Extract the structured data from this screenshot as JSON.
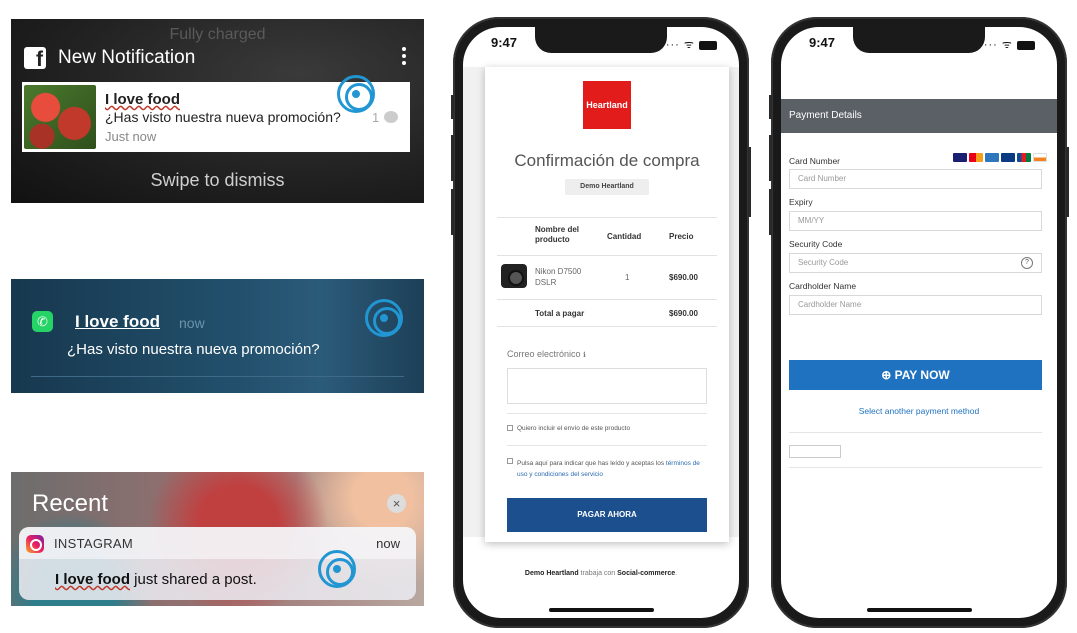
{
  "facebook": {
    "charging": "Fully charged",
    "header": "New Notification",
    "sender": "I love food",
    "message": "¿Has visto nuestra nueva promoción?",
    "time": "Just now",
    "count": "1",
    "swipe": "Swipe to dismiss"
  },
  "whatsapp": {
    "sender": "I love food",
    "time": "now",
    "message": "¿Has visto nuestra nueva promoción?"
  },
  "instagram": {
    "recent": "Recent",
    "close": "×",
    "app": "INSTAGRAM",
    "time": "now",
    "sender": "I love food",
    "message": " just shared a post."
  },
  "checkout": {
    "time": "9:47",
    "logo": "Heartland",
    "title": "Confirmación de compra",
    "badge": "Demo Heartland",
    "col_name": "Nombre del producto",
    "col_qty": "Cantidad",
    "col_price": "Precio",
    "item_name": "Nikon D7500 DSLR",
    "item_qty": "1",
    "item_price": "$690.00",
    "total_label": "Total a pagar",
    "total_value": "$690.00",
    "email_label": "Correo electrónico",
    "check1": "Quiero incluir el envío de este producto",
    "check2": "Pulsa aquí para indicar que has leído y aceptas los",
    "check2_link": "términos de uso y condiciones del servicio",
    "pay_button": "PAGAR AHORA",
    "footer_brand": "Demo Heartland",
    "footer_mid": " trabaja con ",
    "footer_partner": "Social-commerce",
    "footer_end": "."
  },
  "payment": {
    "time": "9:47",
    "header": "Payment Details",
    "card_label": "Card Number",
    "card_placeholder": "Card Number",
    "expiry_label": "Expiry",
    "expiry_placeholder": "MM/YY",
    "cvv_label": "Security Code",
    "cvv_placeholder": "Security Code",
    "name_label": "Cardholder Name",
    "name_placeholder": "Cardholder Name",
    "pay_button": "⊕ PAY NOW",
    "other_method": "Select another payment method"
  },
  "colors": {
    "tap_ring": "#2196d3",
    "heartland_red": "#e21b1b",
    "pay_now_blue": "#1f72c0",
    "pagar_blue": "#1b4f8e"
  }
}
